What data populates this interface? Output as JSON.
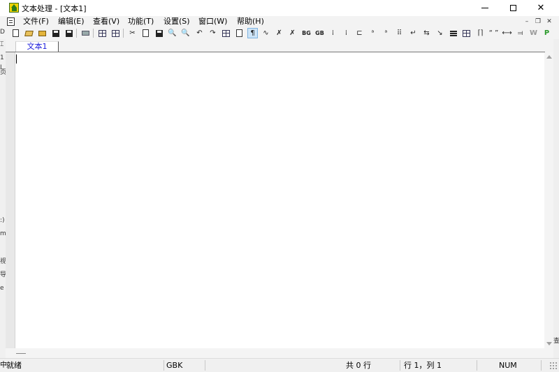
{
  "window": {
    "title": "文本处理 - [文本1]",
    "controls": {
      "minimize": "─",
      "maximize": "☐",
      "close": "✕"
    }
  },
  "menu": {
    "items": [
      "文件(F)",
      "编辑(E)",
      "查看(V)",
      "功能(T)",
      "设置(S)",
      "窗口(W)",
      "帮助(H)"
    ],
    "mdi_controls": {
      "minimize": "–",
      "restore": "❐",
      "close": "✕"
    }
  },
  "toolbar": {
    "text_icons": {
      "cut": "✂",
      "find": "🔍",
      "undo": "↶",
      "redo": "↷",
      "paragraph": "¶",
      "big5_to_gb": "BG",
      "gb_to_big5": "GB",
      "quotes": "“ ”",
      "w": "W",
      "p": "P"
    }
  },
  "left_strip_fragments": [
    "D",
    "1",
    "⌶",
    "I",
    "页",
    ":)",
    "m",
    "视",
    "导",
    "e"
  ],
  "right_edge_fragment": "查",
  "tabs": [
    {
      "label": "文本1",
      "active": true
    }
  ],
  "statusbar": {
    "fragment": "中",
    "status": "就绪",
    "encoding": "GBK",
    "line_count": "共 0 行",
    "cursor_pos": "行 1，列 1",
    "num_lock": "NUM"
  },
  "colors": {
    "tab_text": "#1a1adb",
    "app_icon_bg": "#f2d400",
    "app_icon_fg": "#2e7d1a",
    "active_button_bg": "#cde4f7"
  }
}
